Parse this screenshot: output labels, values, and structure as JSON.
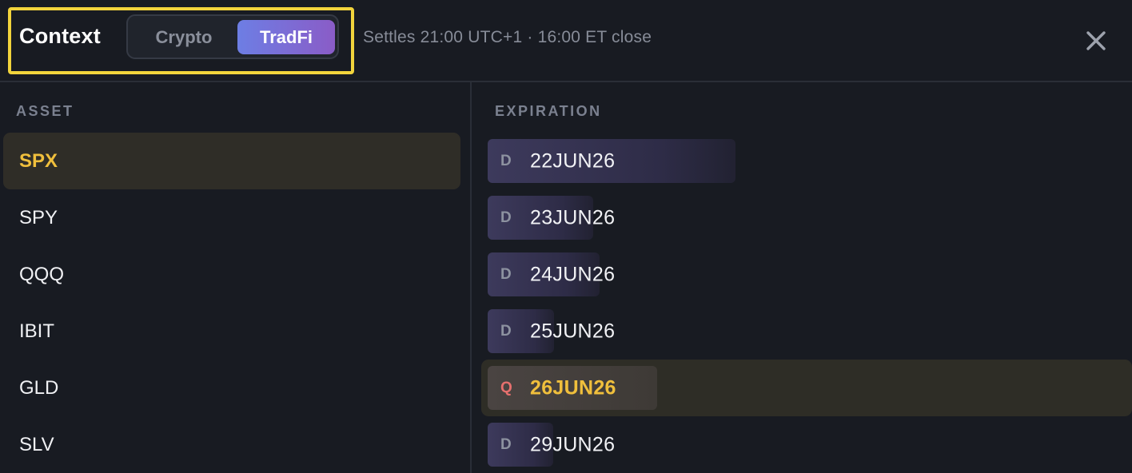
{
  "header": {
    "title": "Context",
    "segments": [
      {
        "label": "Crypto",
        "active": false
      },
      {
        "label": "TradFi",
        "active": true
      }
    ],
    "settles_text": "Settles 21:00 UTC+1 · 16:00 ET close",
    "close_icon": "close-icon"
  },
  "assets": {
    "label": "ASSET",
    "items": [
      {
        "label": "SPX",
        "selected": true
      },
      {
        "label": "SPY",
        "selected": false
      },
      {
        "label": "QQQ",
        "selected": false
      },
      {
        "label": "IBIT",
        "selected": false
      },
      {
        "label": "GLD",
        "selected": false
      },
      {
        "label": "SLV",
        "selected": false
      }
    ]
  },
  "expirations": {
    "label": "EXPIRATION",
    "items": [
      {
        "type": "D",
        "date": "22JUN26",
        "selected": false
      },
      {
        "type": "D",
        "date": "23JUN26",
        "selected": false
      },
      {
        "type": "D",
        "date": "24JUN26",
        "selected": false
      },
      {
        "type": "D",
        "date": "25JUN26",
        "selected": false
      },
      {
        "type": "Q",
        "date": "26JUN26",
        "selected": true
      },
      {
        "type": "D",
        "date": "29JUN26",
        "selected": false
      }
    ]
  },
  "colors": {
    "accent_gold": "#f0bf3c",
    "highlight_outline": "#f2d43c",
    "tradfi_gradient_start": "#6d7ee4",
    "tradfi_gradient_end": "#8a5cc7",
    "quarterly_badge": "#e6706e"
  }
}
